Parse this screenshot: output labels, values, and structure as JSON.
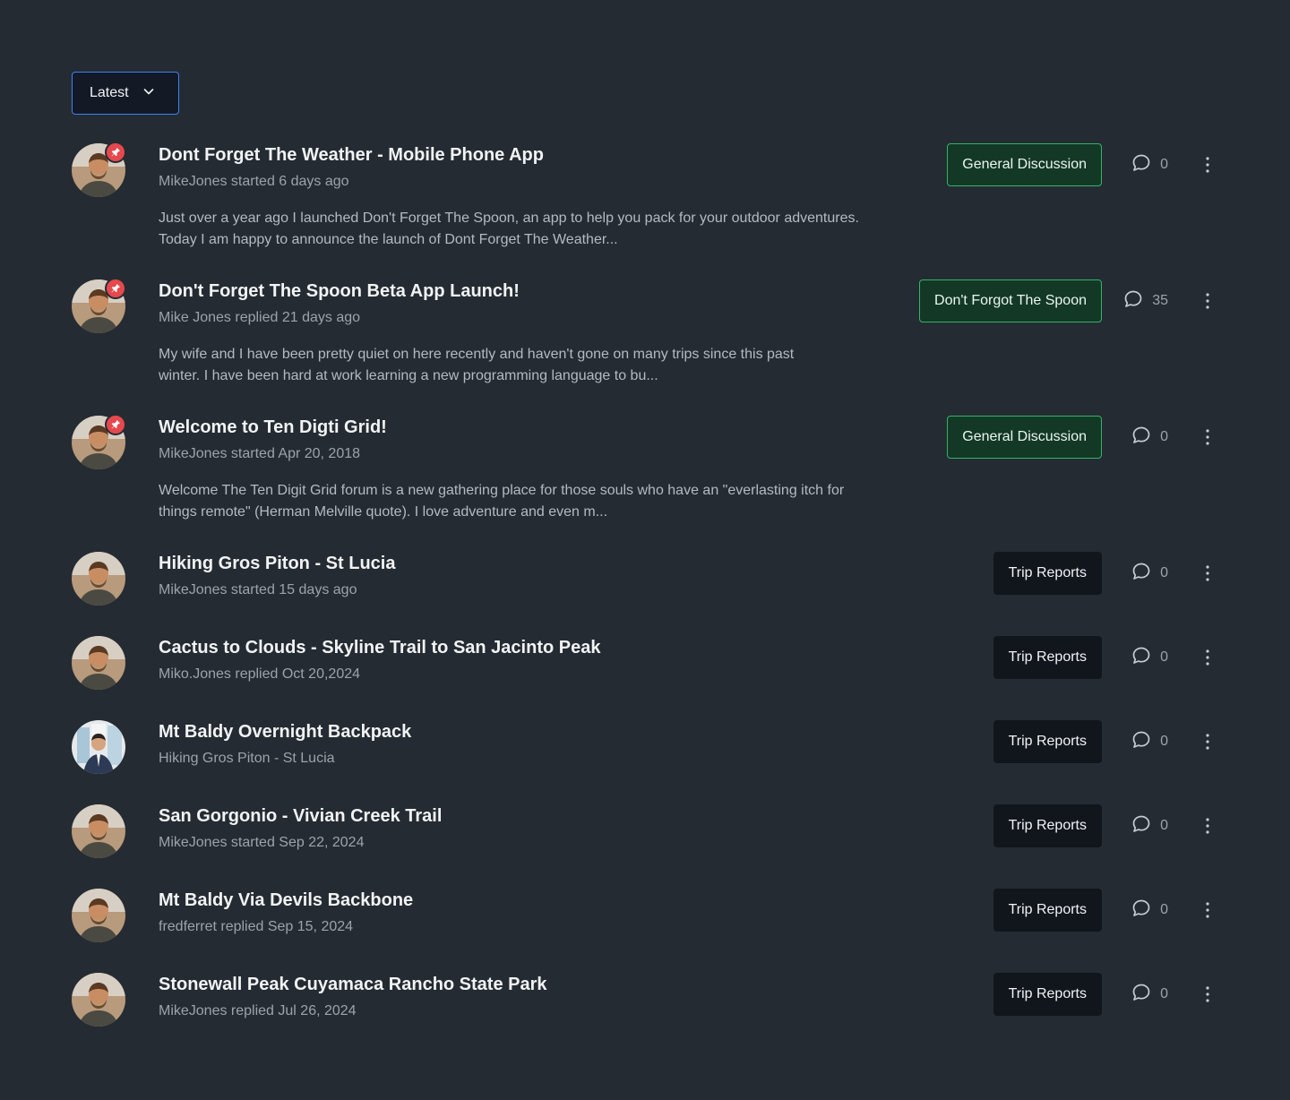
{
  "sort": {
    "label": "Latest"
  },
  "threads": [
    {
      "title": "Dont Forget The Weather - Mobile Phone App",
      "meta": "MikeJones started 6 days ago",
      "excerpt_1": "Just over a year ago I launched Don't Forget The Spoon, an app to help you pack for your outdoor adventures.",
      "excerpt_2": "Today I am happy to announce the launch of Dont Forget The Weather...",
      "category": "General Discussion",
      "replies": "0",
      "pinned": true
    },
    {
      "title": "Don't Forget The Spoon Beta App Launch!",
      "meta": "Mike Jones replied 21 days ago",
      "excerpt_1": "My wife and I have been pretty quiet on here recently and haven't gone on many trips since this past",
      "excerpt_2": "winter. I have been hard at work learning a new programming language to bu...",
      "category": "Don't Forgot The Spoon",
      "replies": "35",
      "pinned": true
    },
    {
      "title": "Welcome to Ten Digti Grid!",
      "meta": "MikeJones started Apr 20, 2018",
      "excerpt_1": "Welcome The Ten Digit Grid forum is a new gathering place for those souls who have an \"everlasting itch for",
      "excerpt_2": "things remote\" (Herman Melville quote). I love adventure and even m...",
      "category": "General Discussion",
      "replies": "0",
      "pinned": true
    },
    {
      "title": "Hiking Gros Piton - St Lucia",
      "meta": "MikeJones started 15 days ago",
      "category": "Trip Reports",
      "replies": "0"
    },
    {
      "title": "Cactus to Clouds - Skyline Trail to San Jacinto Peak",
      "meta": "Miko.Jones replied Oct 20,2024",
      "category": "Trip Reports",
      "replies": "0"
    },
    {
      "title": "Mt Baldy Overnight Backpack",
      "meta": "Hiking Gros Piton - St Lucia",
      "category": "Trip Reports",
      "replies": "0"
    },
    {
      "title": "San Gorgonio - Vivian Creek Trail",
      "meta": "MikeJones started Sep 22, 2024",
      "category": "Trip Reports",
      "replies": "0"
    },
    {
      "title": "Mt Baldy Via Devils Backbone",
      "meta": "fredferret replied Sep 15, 2024",
      "category": "Trip Reports",
      "replies": "0"
    },
    {
      "title": "Stonewall Peak Cuyamaca Rancho State Park",
      "meta": "MikeJones replied Jul 26, 2024",
      "category": "Trip Reports",
      "replies": "0"
    }
  ],
  "colors": {
    "background": "#252b32",
    "pin": "#e5484d",
    "general_tag_border": "#2fb56a",
    "sort_border": "#3b82f6"
  }
}
